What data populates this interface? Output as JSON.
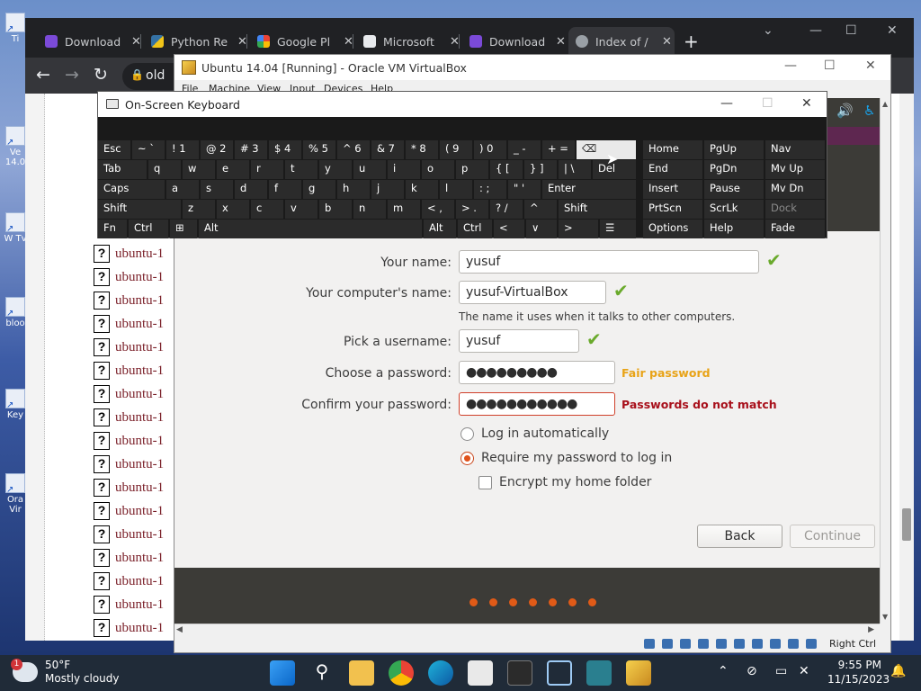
{
  "desktop": {
    "icons": [
      "Ti",
      "Ve 14.0",
      "W Tv",
      "bloo",
      "Key",
      "Ora Vir"
    ]
  },
  "chrome": {
    "tabs": [
      {
        "title": "Download",
        "icon": "app-icon",
        "color": "#7b4ad8"
      },
      {
        "title": "Python Re",
        "icon": "python-icon",
        "color": "#f0c419"
      },
      {
        "title": "Google Pl",
        "icon": "google-photos-icon",
        "color": "#ea4335"
      },
      {
        "title": "Microsoft",
        "icon": "bank-icon",
        "color": "#e8eaed"
      },
      {
        "title": "Download",
        "icon": "app-icon",
        "color": "#7b4ad8"
      },
      {
        "title": "Index of /",
        "icon": "globe-icon",
        "color": "#9aa0a6"
      }
    ],
    "address": "old",
    "page_list": [
      "ubuntu-1",
      "ubuntu-1",
      "ubuntu-1",
      "ubuntu-1",
      "ubuntu-1",
      "ubuntu-1",
      "ubuntu-1",
      "ubuntu-1",
      "ubuntu-1",
      "ubuntu-1",
      "ubuntu-1",
      "ubuntu-1",
      "ubuntu-1",
      "ubuntu-1",
      "ubuntu-1",
      "ubuntu-1",
      "ubuntu-1"
    ]
  },
  "vbox": {
    "title": "Ubuntu 14.04 [Running] - Oracle VM VirtualBox",
    "menu": [
      "File",
      "Machine",
      "View",
      "Input",
      "Devices",
      "Help"
    ],
    "host_key": "Right Ctrl"
  },
  "installer": {
    "your_name_label": "Your name:",
    "your_name_value": "yusuf",
    "computer_name_label": "Your computer's name:",
    "computer_name_value": "yusuf-VirtualBox",
    "computer_name_hint": "The name it uses when it talks to other computers.",
    "username_label": "Pick a username:",
    "username_value": "yusuf",
    "password_label": "Choose a password:",
    "password_value": "●●●●●●●●●",
    "password_strength": "Fair password",
    "confirm_label": "Confirm your password:",
    "confirm_value": "●●●●●●●●●●●",
    "confirm_error": "Passwords do not match",
    "option_auto_login": "Log in automatically",
    "option_require_password": "Require my password to log in",
    "option_encrypt": "Encrypt my home folder",
    "back_label": "Back",
    "continue_label": "Continue",
    "colors": {
      "ok": "#6aaa2c",
      "warning": "#e8a317",
      "error": "#a8101b",
      "accent": "#e0521b"
    }
  },
  "osk": {
    "title": "On-Screen Keyboard",
    "row1": [
      "Esc",
      "~ `",
      "! 1",
      "@ 2",
      "# 3",
      "$ 4",
      "% 5",
      "^ 6",
      "& 7",
      "* 8",
      "( 9",
      ") 0",
      "_ -",
      "+ =",
      "⌫"
    ],
    "row2": [
      "Tab",
      "q",
      "w",
      "e",
      "r",
      "t",
      "y",
      "u",
      "i",
      "o",
      "p",
      "{ [",
      "} ]",
      "| \\",
      "Del"
    ],
    "row3": [
      "Caps",
      "a",
      "s",
      "d",
      "f",
      "g",
      "h",
      "j",
      "k",
      "l",
      ": ;",
      "\" '",
      "Enter"
    ],
    "row4": [
      "Shift",
      "z",
      "x",
      "c",
      "v",
      "b",
      "n",
      "m",
      "< ,",
      "> .",
      "? /",
      "^",
      "Shift"
    ],
    "row5": [
      "Fn",
      "Ctrl",
      "⊞",
      "Alt",
      "Alt",
      "Ctrl",
      "<",
      "∨",
      ">",
      "☰"
    ],
    "side_col1": [
      "Home",
      "End",
      "Insert",
      "PrtScn",
      "Options"
    ],
    "side_col2": [
      "PgUp",
      "PgDn",
      "Pause",
      "ScrLk",
      "Help"
    ],
    "side_col3": [
      "Nav",
      "Mv Up",
      "Mv Dn",
      "Dock",
      "Fade"
    ]
  },
  "taskbar": {
    "temp": "50°F",
    "weather": "Mostly cloudy",
    "time": "9:55 PM",
    "date": "11/15/2023"
  }
}
